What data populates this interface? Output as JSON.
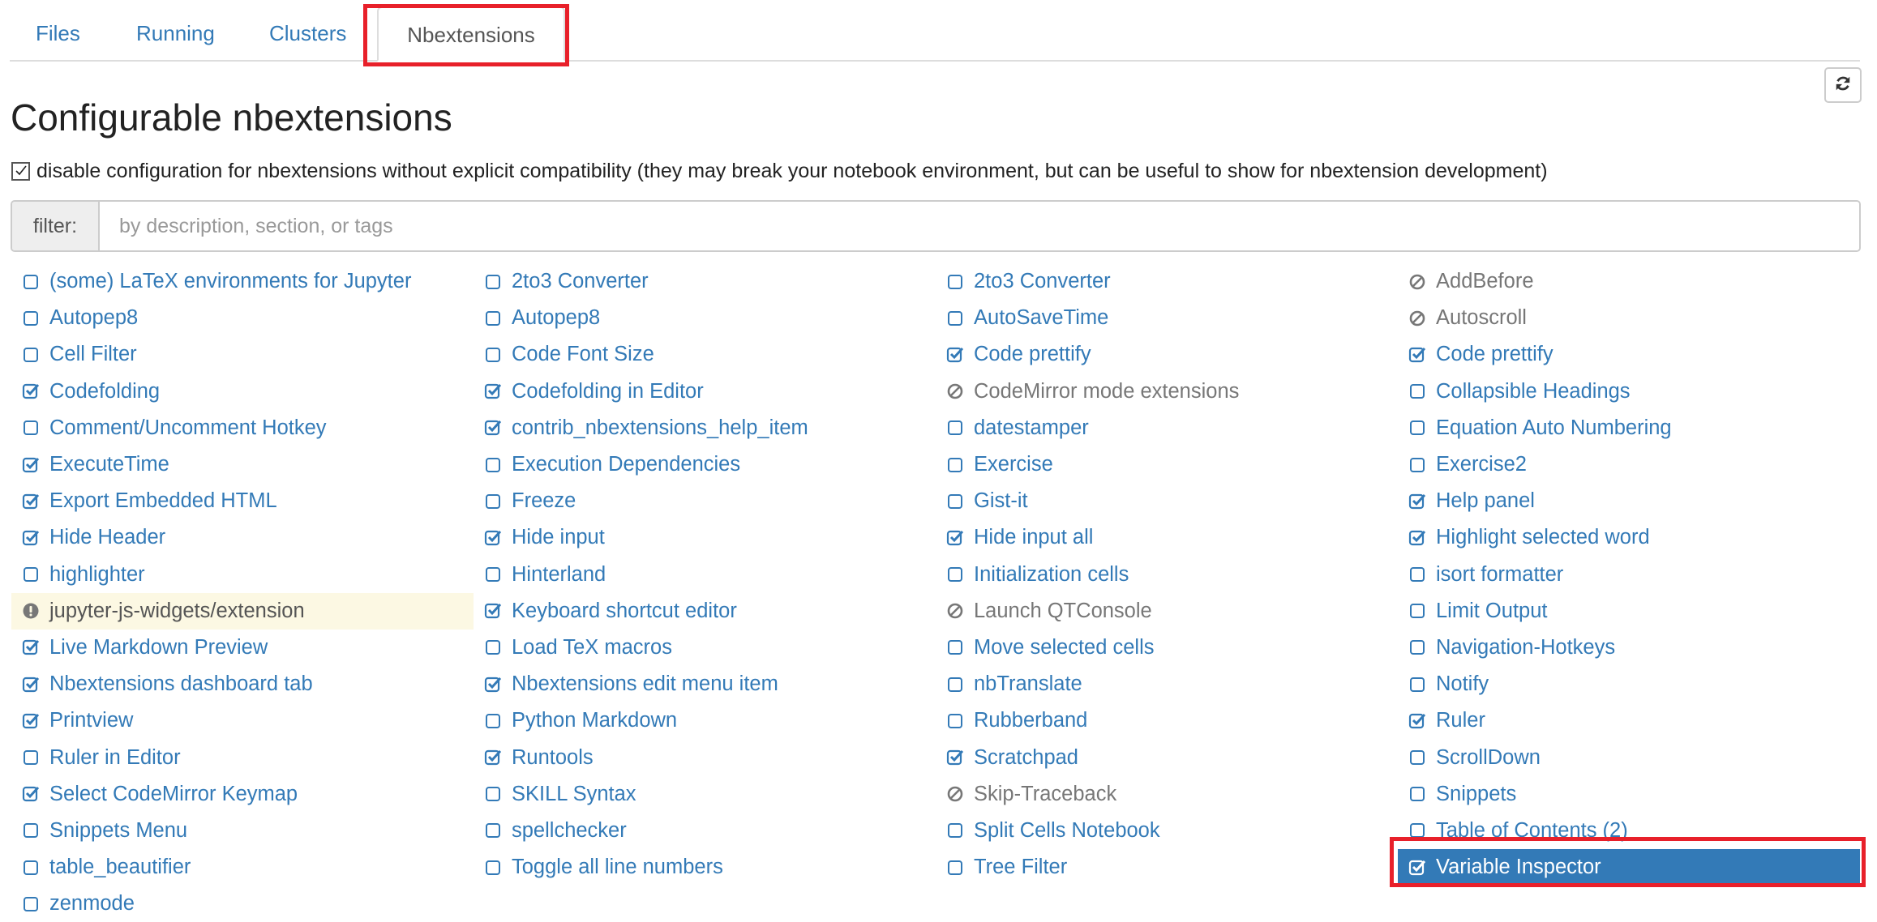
{
  "tabs": {
    "files": "Files",
    "running": "Running",
    "clusters": "Clusters",
    "nbextensions": "Nbextensions"
  },
  "page": {
    "title": "Configurable nbextensions",
    "compat_checkbox_checked": true,
    "compat_label": "disable configuration for nbextensions without explicit compatibility (they may break your notebook environment, but can be useful to show for nbextension development)"
  },
  "filter": {
    "label": "filter:",
    "placeholder": "by description, section, or tags"
  },
  "colors": {
    "link": "#337ab7",
    "disabled_text": "#777777",
    "warning_bg": "#fcf8e3",
    "selected_bg": "#337ab7",
    "highlight_border": "#e8202a"
  },
  "extensions": [
    [
      {
        "label": "(some) LaTeX environments for Jupyter",
        "state": "unchecked"
      },
      {
        "label": "2to3 Converter",
        "state": "unchecked"
      },
      {
        "label": "2to3 Converter",
        "state": "unchecked"
      },
      {
        "label": "AddBefore",
        "state": "unsupported"
      }
    ],
    [
      {
        "label": "Autopep8",
        "state": "unchecked"
      },
      {
        "label": "Autopep8",
        "state": "unchecked"
      },
      {
        "label": "AutoSaveTime",
        "state": "unchecked"
      },
      {
        "label": "Autoscroll",
        "state": "unsupported"
      }
    ],
    [
      {
        "label": "Cell Filter",
        "state": "unchecked"
      },
      {
        "label": "Code Font Size",
        "state": "unchecked"
      },
      {
        "label": "Code prettify",
        "state": "checked"
      },
      {
        "label": "Code prettify",
        "state": "checked"
      }
    ],
    [
      {
        "label": "Codefolding",
        "state": "checked"
      },
      {
        "label": "Codefolding in Editor",
        "state": "checked"
      },
      {
        "label": "CodeMirror mode extensions",
        "state": "unsupported"
      },
      {
        "label": "Collapsible Headings",
        "state": "unchecked"
      }
    ],
    [
      {
        "label": "Comment/Uncomment Hotkey",
        "state": "unchecked"
      },
      {
        "label": "contrib_nbextensions_help_item",
        "state": "checked"
      },
      {
        "label": "datestamper",
        "state": "unchecked"
      },
      {
        "label": "Equation Auto Numbering",
        "state": "unchecked"
      }
    ],
    [
      {
        "label": "ExecuteTime",
        "state": "checked"
      },
      {
        "label": "Execution Dependencies",
        "state": "unchecked"
      },
      {
        "label": "Exercise",
        "state": "unchecked"
      },
      {
        "label": "Exercise2",
        "state": "unchecked"
      }
    ],
    [
      {
        "label": "Export Embedded HTML",
        "state": "checked"
      },
      {
        "label": "Freeze",
        "state": "unchecked"
      },
      {
        "label": "Gist-it",
        "state": "unchecked"
      },
      {
        "label": "Help panel",
        "state": "checked"
      }
    ],
    [
      {
        "label": "Hide Header",
        "state": "checked"
      },
      {
        "label": "Hide input",
        "state": "checked"
      },
      {
        "label": "Hide input all",
        "state": "checked"
      },
      {
        "label": "Highlight selected word",
        "state": "checked"
      }
    ],
    [
      {
        "label": "highlighter",
        "state": "unchecked"
      },
      {
        "label": "Hinterland",
        "state": "unchecked"
      },
      {
        "label": "Initialization cells",
        "state": "unchecked"
      },
      {
        "label": "isort formatter",
        "state": "unchecked"
      }
    ],
    [
      {
        "label": "jupyter-js-widgets/extension",
        "state": "warning"
      },
      {
        "label": "Keyboard shortcut editor",
        "state": "checked"
      },
      {
        "label": "Launch QTConsole",
        "state": "unsupported"
      },
      {
        "label": "Limit Output",
        "state": "unchecked"
      }
    ],
    [
      {
        "label": "Live Markdown Preview",
        "state": "checked"
      },
      {
        "label": "Load TeX macros",
        "state": "unchecked"
      },
      {
        "label": "Move selected cells",
        "state": "unchecked"
      },
      {
        "label": "Navigation-Hotkeys",
        "state": "unchecked"
      }
    ],
    [
      {
        "label": "Nbextensions dashboard tab",
        "state": "checked"
      },
      {
        "label": "Nbextensions edit menu item",
        "state": "checked"
      },
      {
        "label": "nbTranslate",
        "state": "unchecked"
      },
      {
        "label": "Notify",
        "state": "unchecked"
      }
    ],
    [
      {
        "label": "Printview",
        "state": "checked"
      },
      {
        "label": "Python Markdown",
        "state": "unchecked"
      },
      {
        "label": "Rubberband",
        "state": "unchecked"
      },
      {
        "label": "Ruler",
        "state": "checked"
      }
    ],
    [
      {
        "label": "Ruler in Editor",
        "state": "unchecked"
      },
      {
        "label": "Runtools",
        "state": "checked"
      },
      {
        "label": "Scratchpad",
        "state": "checked"
      },
      {
        "label": "ScrollDown",
        "state": "unchecked"
      }
    ],
    [
      {
        "label": "Select CodeMirror Keymap",
        "state": "checked"
      },
      {
        "label": "SKILL Syntax",
        "state": "unchecked"
      },
      {
        "label": "Skip-Traceback",
        "state": "unsupported"
      },
      {
        "label": "Snippets",
        "state": "unchecked"
      }
    ],
    [
      {
        "label": "Snippets Menu",
        "state": "unchecked"
      },
      {
        "label": "spellchecker",
        "state": "unchecked"
      },
      {
        "label": "Split Cells Notebook",
        "state": "unchecked"
      },
      {
        "label": "Table of Contents (2)",
        "state": "unchecked"
      }
    ],
    [
      {
        "label": "table_beautifier",
        "state": "unchecked"
      },
      {
        "label": "Toggle all line numbers",
        "state": "unchecked"
      },
      {
        "label": "Tree Filter",
        "state": "unchecked"
      },
      {
        "label": "Variable Inspector",
        "state": "checked",
        "selected": true
      }
    ],
    [
      {
        "label": "zenmode",
        "state": "unchecked"
      }
    ]
  ]
}
